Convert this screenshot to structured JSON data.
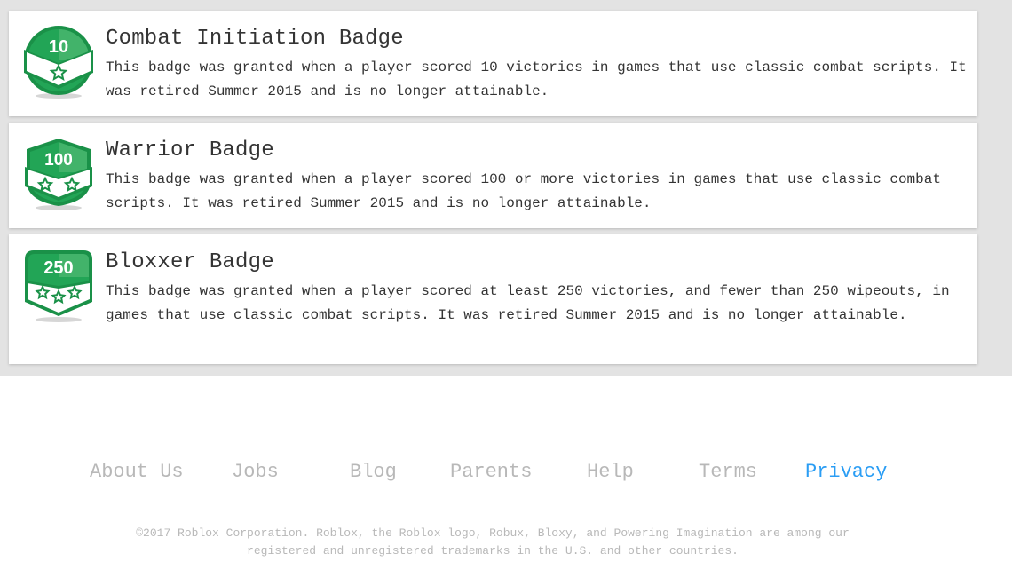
{
  "badges": [
    {
      "title": "Combat Initiation Badge",
      "description": "This badge was granted when a player scored 10 victories in games that use classic combat scripts. It was retired Summer 2015 and is no longer attainable.",
      "icon_number": "10",
      "icon": "combat-initiation-badge-icon"
    },
    {
      "title": "Warrior Badge",
      "description": "This badge was granted when a player scored 100 or more victories in games that use classic combat scripts. It was retired Summer 2015 and is no longer attainable.",
      "icon_number": "100",
      "icon": "warrior-badge-icon"
    },
    {
      "title": "Bloxxer Badge",
      "description": "This badge was granted when a player scored at least 250 victories, and fewer than 250 wipeouts, in games that use classic combat scripts. It was retired Summer 2015 and is no longer attainable.",
      "icon_number": "250",
      "icon": "bloxxer-badge-icon"
    }
  ],
  "footer": {
    "links": [
      "About Us",
      "Jobs",
      "Blog",
      "Parents",
      "Help",
      "Terms",
      "Privacy"
    ],
    "active_link": "Privacy",
    "copyright": "©2017 Roblox Corporation. Roblox, the Roblox logo, Robux, Bloxy, and Powering Imagination are among our registered and unregistered trademarks in the U.S. and other countries."
  },
  "colors": {
    "page_background": "#e3e3e3",
    "card_background": "#ffffff",
    "text": "#343434",
    "footer_text": "#b8b8b8",
    "link_active": "#2a9df4",
    "badge_green": "#1fa055",
    "badge_light": "#7fcf95"
  }
}
